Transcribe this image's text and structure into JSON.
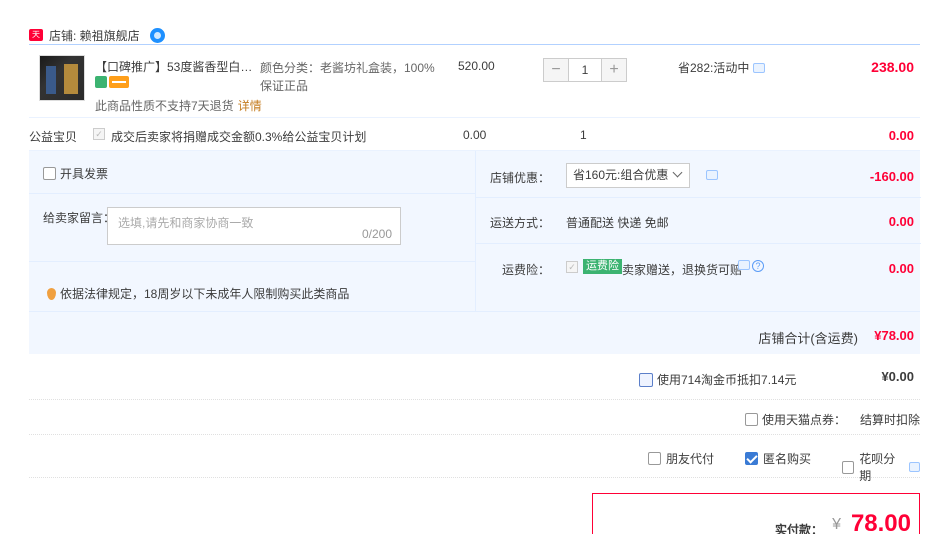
{
  "shop": {
    "badge": "天猫",
    "label": "店铺: 赖祖旗舰店"
  },
  "item": {
    "title": "【口碑推广】53度酱香型白酒...",
    "note": "此商品性质不支持7天退货",
    "note_link": "详情",
    "sku_line1": "颜色分类：老酱坊礼盒装，100%",
    "sku_line2": "保证正品",
    "price": "520.00",
    "qty_minus": "−",
    "qty": "1",
    "qty_plus": "+",
    "saving": "省282:活动中",
    "total": "238.00"
  },
  "charity": {
    "label": "公益宝贝",
    "check": "✓",
    "text": "成交后卖家将捐赠成交金额0.3%给公益宝贝计划",
    "price": "0.00",
    "qty": "1",
    "total": "0.00"
  },
  "invoice": {
    "label": "开具发票"
  },
  "message": {
    "label": "给卖家留言：",
    "placeholder": "选填,请先和商家协商一致",
    "count": "0/200"
  },
  "legal": {
    "text": "依据法律规定，18周岁以下未成年人限制购买此类商品"
  },
  "coupon": {
    "label": "店铺优惠：",
    "selected": "省160元:组合优惠",
    "value": "-160.00"
  },
  "shipping": {
    "label": "运送方式：",
    "text": "普通配送 快递 免邮",
    "value": "0.00"
  },
  "insurance": {
    "label": "运费险：",
    "check": "✓",
    "tag": "运费险",
    "text": "卖家赠送，退换货可赔",
    "help": "?",
    "value": "0.00"
  },
  "shop_total": {
    "label": "店铺合计(含运费)",
    "value": "¥78.00"
  },
  "coins": {
    "label": "使用714淘金币抵扣7.14元",
    "value": "¥0.00"
  },
  "tmall_points": {
    "label": "使用天猫点券：",
    "deduct": "结算时扣除"
  },
  "pay_options": [
    {
      "label": "朋友代付",
      "checked": false
    },
    {
      "label": "匿名购买",
      "checked": true
    },
    {
      "label": "花呗分期",
      "checked": false
    }
  ],
  "final": {
    "label": "实付款：",
    "symbol": "¥",
    "value": "78.00"
  },
  "colors": {
    "accent": "#ff0036",
    "panel_bg": "#f2f7ff",
    "border_blue": "#b2d1ff",
    "check_blue": "#3a7bd5"
  }
}
